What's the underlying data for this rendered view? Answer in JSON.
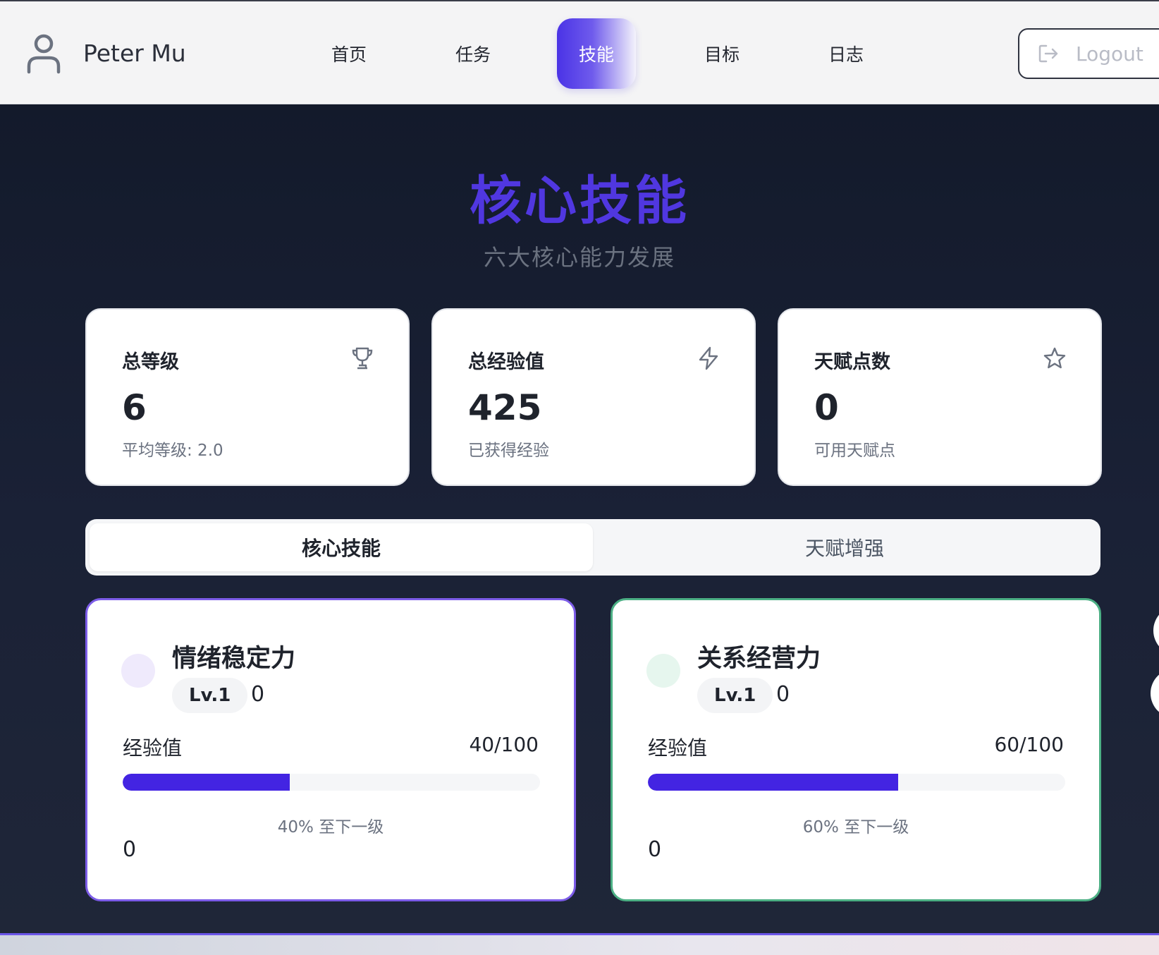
{
  "header": {
    "user_name": "Peter Mu",
    "nav": [
      {
        "label": "首页",
        "active": false
      },
      {
        "label": "任务",
        "active": false
      },
      {
        "label": "技能",
        "active": true
      },
      {
        "label": "目标",
        "active": false
      },
      {
        "label": "日志",
        "active": false
      }
    ],
    "logout_label": "Logout",
    "icons": {
      "user": "user-icon",
      "logout": "logout-icon"
    }
  },
  "page": {
    "title": "核心技能",
    "subtitle": "六大核心能力发展"
  },
  "stats": [
    {
      "label": "总等级",
      "value": "6",
      "sub": "平均等级: 2.0",
      "icon": "trophy-icon"
    },
    {
      "label": "总经验值",
      "value": "425",
      "sub": "已获得经验",
      "icon": "lightning-icon"
    },
    {
      "label": "天赋点数",
      "value": "0",
      "sub": "可用天赋点",
      "icon": "star-icon"
    }
  ],
  "tabs": [
    {
      "label": "核心技能",
      "active": true
    },
    {
      "label": "天赋增强",
      "active": false
    }
  ],
  "skills": [
    {
      "name": "情绪稳定力",
      "level": "Lv.1",
      "level_extra": "0",
      "exp_label": "经验值",
      "exp_value": "40/100",
      "progress": 0.4,
      "progress_text": "40% 至下一级",
      "bottom_value": "0",
      "border_color": "#7c5ce8",
      "dot_color": "#efeafc"
    },
    {
      "name": "关系经营力",
      "level": "Lv.1",
      "level_extra": "0",
      "exp_label": "经验值",
      "exp_value": "60/100",
      "progress": 0.6,
      "progress_text": "60% 至下一级",
      "bottom_value": "0",
      "border_color": "#4caf84",
      "dot_color": "#e6f6ee"
    }
  ],
  "colors": {
    "accent": "#5037e0",
    "progress_fill": "#4324e2",
    "background": "#141a2c"
  }
}
